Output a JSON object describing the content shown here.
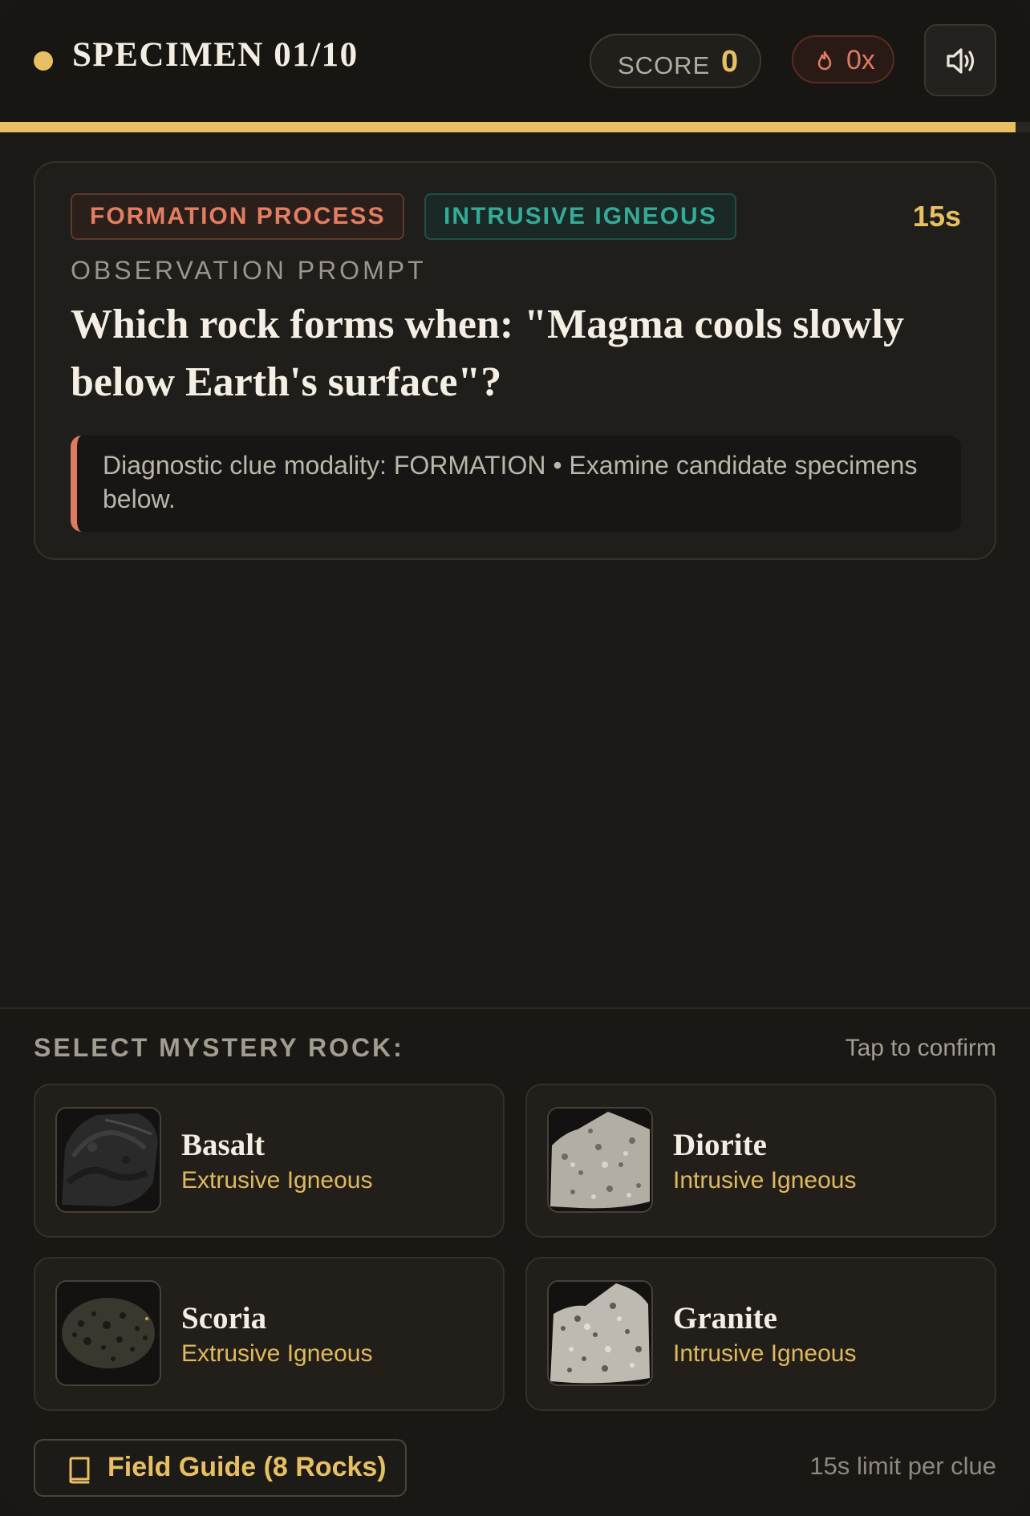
{
  "header": {
    "specimen_title": "SPECIMEN 01/10",
    "score_label": "SCORE",
    "score_value": "0",
    "streak_value": "0x",
    "progress_fraction": 0.986,
    "icons": {
      "status": "status-dot",
      "streak": "flame-icon",
      "sound": "speaker-icon"
    }
  },
  "question_card": {
    "tags": [
      "FORMATION PROCESS",
      "INTRUSIVE IGNEOUS"
    ],
    "timer": "15s",
    "observation_label": "OBSERVATION PROMPT",
    "question": "Which rock forms when: \"Magma cools slowly below Earth's surface\"?",
    "clue": "Diagnostic clue modality: FORMATION • Examine candidate specimens below."
  },
  "selection": {
    "heading": "SELECT MYSTERY ROCK:",
    "hint": "Tap to confirm",
    "options": [
      {
        "name": "Basalt",
        "type": "Extrusive Igneous"
      },
      {
        "name": "Diorite",
        "type": "Intrusive Igneous"
      },
      {
        "name": "Scoria",
        "type": "Extrusive Igneous"
      },
      {
        "name": "Granite",
        "type": "Intrusive Igneous"
      }
    ]
  },
  "footer": {
    "field_guide_label": "Field Guide (8 Rocks)",
    "limit_note": "15s limit per clue"
  },
  "colors": {
    "accent": "#e8c063",
    "formation_tag": "#e47e62",
    "intrusive_tag": "#33ab97",
    "background": "#1c1a17"
  }
}
